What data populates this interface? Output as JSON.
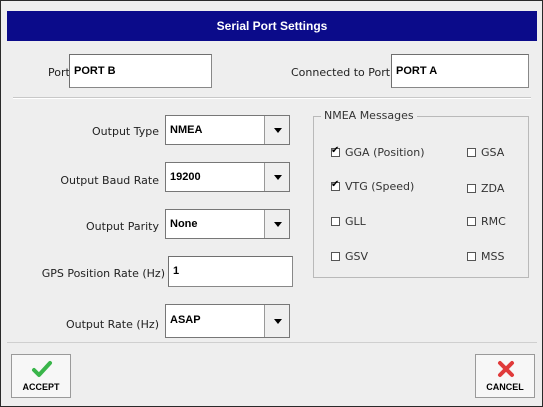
{
  "dialog": {
    "title": "Serial Port Settings"
  },
  "port": {
    "label": "Port",
    "value": "PORT B"
  },
  "connected": {
    "label": "Connected to Port",
    "value": "PORT A"
  },
  "output_type": {
    "label": "Output Type",
    "value": "NMEA"
  },
  "baud_rate": {
    "label": "Output Baud Rate",
    "value": "19200"
  },
  "parity": {
    "label": "Output Parity",
    "value": "None"
  },
  "gps_rate": {
    "label": "GPS Position Rate (Hz)",
    "value": "1"
  },
  "output_rate": {
    "label": "Output Rate (Hz)",
    "value": "ASAP"
  },
  "nmea": {
    "title": "NMEA Messages",
    "items": [
      {
        "label": "GGA (Position)",
        "checked": true
      },
      {
        "label": "GSA",
        "checked": false
      },
      {
        "label": "VTG (Speed)",
        "checked": true
      },
      {
        "label": "ZDA",
        "checked": false
      },
      {
        "label": "GLL",
        "checked": false
      },
      {
        "label": "RMC",
        "checked": false
      },
      {
        "label": "GSV",
        "checked": false
      },
      {
        "label": "MSS",
        "checked": false
      }
    ]
  },
  "buttons": {
    "accept": "ACCEPT",
    "cancel": "CANCEL"
  },
  "icons": {
    "accept": "green-checkmark-icon",
    "cancel": "red-x-icon"
  },
  "colors": {
    "titlebar": "#0b0b8a",
    "accept_icon": "#39b54a",
    "cancel_icon": "#e03a3a"
  }
}
